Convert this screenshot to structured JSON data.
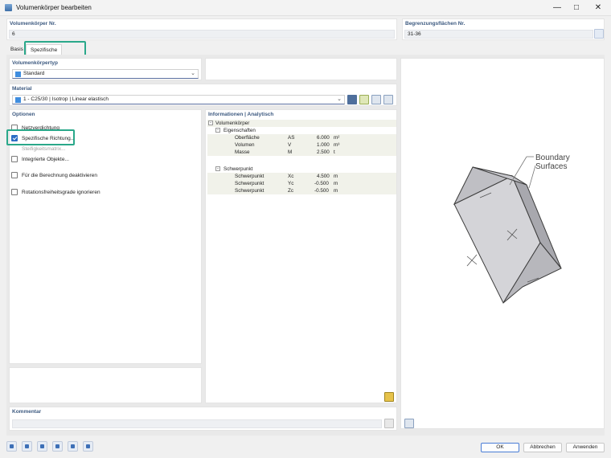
{
  "window": {
    "title": "Volumenkörper bearbeiten"
  },
  "header": {
    "number_label": "Volumenkörper Nr.",
    "number_value": "6",
    "surfaces_label": "Begrenzungsflächen Nr.",
    "surfaces_value": "31-36"
  },
  "tabs": [
    {
      "label": "Basis"
    },
    {
      "label": "Spezifische Richtung"
    }
  ],
  "solid_type": {
    "label": "Volumenkörpertyp",
    "value": "Standard",
    "color": "#3f8ddf"
  },
  "material": {
    "label": "Material",
    "value": "1 - C25/30 | Isotrop | Linear elastisch",
    "color": "#3f8ddf"
  },
  "options": {
    "label": "Optionen",
    "items": [
      {
        "label": "Netzverdichtung",
        "checked": false
      },
      {
        "label": "Spezifische Richtung...",
        "checked": true
      },
      {
        "label": "Steifigkeitsmatrix...",
        "checked": false
      },
      {
        "label": "Integrierte Objekte...",
        "checked": false
      },
      {
        "label": "Für die Berechnung deaktivieren",
        "checked": false
      },
      {
        "label": "Rotationsfreiheitsgrade ignorieren",
        "checked": false
      }
    ]
  },
  "info": {
    "label": "Informationen | Analytisch",
    "root": "Volumenkörper",
    "props_group": "Eigenschaften",
    "props": [
      {
        "name": "Oberfläche",
        "sym": "AS",
        "value": "6.000",
        "unit": "m²"
      },
      {
        "name": "Volumen",
        "sym": "V",
        "value": "1.000",
        "unit": "m³"
      },
      {
        "name": "Masse",
        "sym": "M",
        "value": "2.500",
        "unit": "t"
      }
    ],
    "centroid_group": "Schwerpunkt",
    "centroid": [
      {
        "name": "Schwerpunkt",
        "sym": "Xc",
        "value": "4.500",
        "unit": "m"
      },
      {
        "name": "Schwerpunkt",
        "sym": "Yc",
        "value": "-0.500",
        "unit": "m"
      },
      {
        "name": "Schwerpunkt",
        "sym": "Zc",
        "value": "-0.500",
        "unit": "m"
      }
    ]
  },
  "preview": {
    "annotation_line1": "Boundary",
    "annotation_line2": "Surfaces"
  },
  "comment": {
    "label": "Kommentar",
    "value": ""
  },
  "buttons": {
    "ok": "OK",
    "cancel": "Abbrechen",
    "apply": "Anwenden"
  },
  "accent_color": "#2aa88a"
}
